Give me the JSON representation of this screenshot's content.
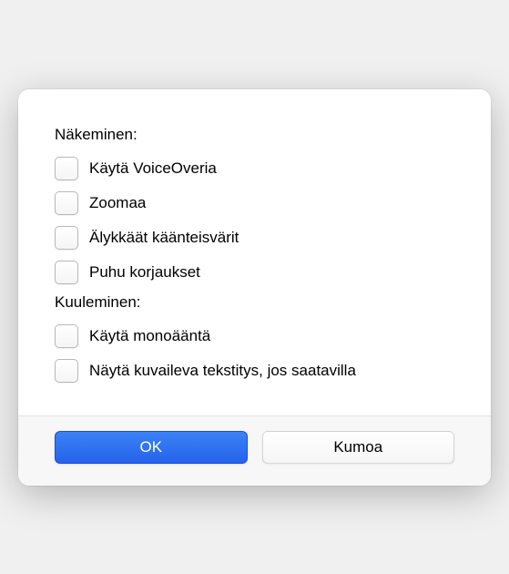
{
  "sections": {
    "vision": {
      "label": "Näkeminen:",
      "options": [
        {
          "label": "Käytä VoiceOveria",
          "checked": false
        },
        {
          "label": "Zoomaa",
          "checked": false
        },
        {
          "label": "Älykkäät käänteisvärit",
          "checked": false
        },
        {
          "label": "Puhu korjaukset",
          "checked": false
        }
      ]
    },
    "hearing": {
      "label": "Kuuleminen:",
      "options": [
        {
          "label": "Käytä monoääntä",
          "checked": false
        },
        {
          "label": "Näytä kuvaileva tekstitys, jos saatavilla",
          "checked": false
        }
      ]
    }
  },
  "buttons": {
    "ok": "OK",
    "cancel": "Kumoa"
  }
}
